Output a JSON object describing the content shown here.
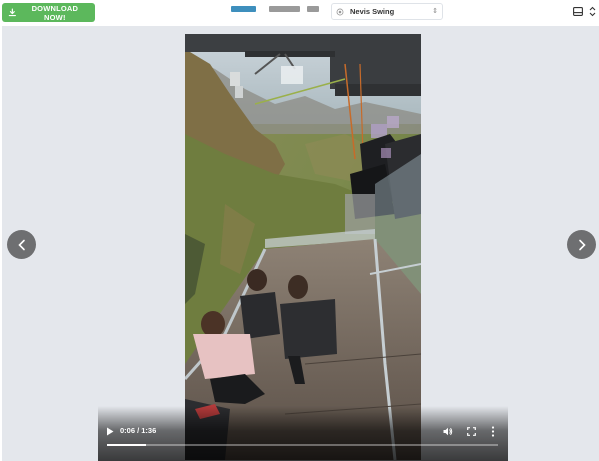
{
  "toolbar": {
    "download_label": "DOWNLOAD NOW!",
    "download_icon": "download-icon",
    "select": {
      "icon": "location-icon",
      "selected": "Nevis Swing"
    },
    "layout_icon": "layout-icon",
    "sort_icon": "sort-icon"
  },
  "viewer": {
    "prev_icon": "chevron-left-icon",
    "next_icon": "chevron-right-icon"
  },
  "video": {
    "time_display": "0:06 / 1:36",
    "progress": 0.1
  },
  "colors": {
    "download_bg": "#5cb85c",
    "stage_bg": "#e4e7ec",
    "nav_bg": "#6e6f71"
  }
}
